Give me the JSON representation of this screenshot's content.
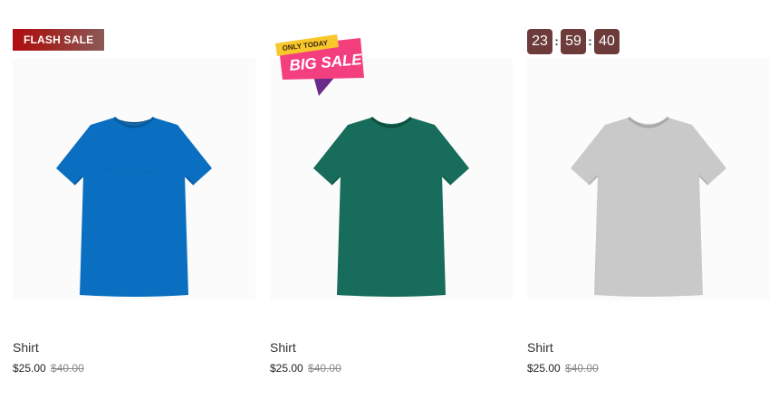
{
  "products": [
    {
      "name": "Shirt",
      "price": "$25.00",
      "old_price": "$40.00",
      "badge": "FLASH SALE",
      "shirt_color": "#0a6fc0",
      "shirt_icon": "t-shirt-blue-image"
    },
    {
      "name": "Shirt",
      "price": "$25.00",
      "old_price": "$40.00",
      "sticker_top": "ONLY TODAY",
      "sticker_main": "BIG SALE",
      "shirt_color": "#176c5b",
      "shirt_icon": "t-shirt-green-image"
    },
    {
      "name": "Shirt",
      "price": "$25.00",
      "old_price": "$40.00",
      "countdown": {
        "hours": "23",
        "minutes": "59",
        "seconds": "40",
        "separator": ":"
      },
      "shirt_color": "#c9c9c9",
      "shirt_icon": "t-shirt-grey-image"
    }
  ],
  "colors": {
    "flash_badge": "#b10d12",
    "countdown_box": "#6e3b3b",
    "sticker_pink": "#f43f7f",
    "sticker_yellow": "#f7c72b",
    "sticker_purple": "#6a2a8a"
  }
}
